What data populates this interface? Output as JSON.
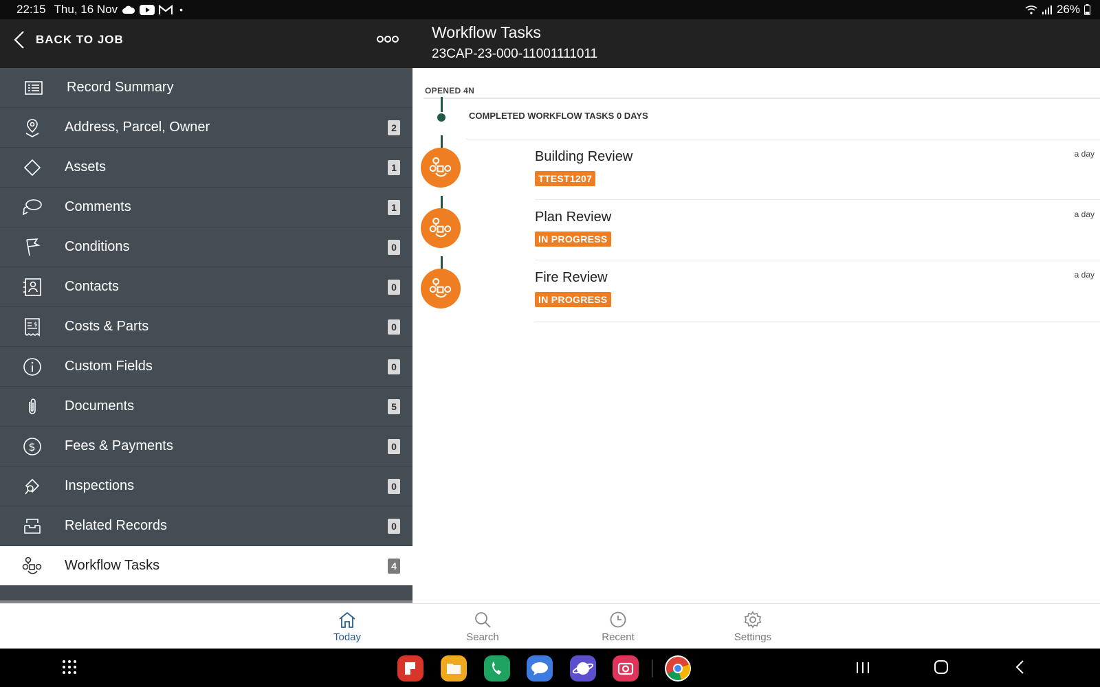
{
  "status": {
    "time": "22:15",
    "date": "Thu, 16 Nov",
    "battery": "26%",
    "notification_icons": [
      "cloud-icon",
      "youtube-icon",
      "gmail-icon",
      "dot-icon"
    ]
  },
  "header": {
    "back_label": "BACK TO JOB",
    "more_label": "ooo",
    "title": "Workflow Tasks",
    "subtitle": "23CAP-23-000-11001111011"
  },
  "sidebar": {
    "items": [
      {
        "label": "Record Summary",
        "count": null,
        "icon": "record-summary-icon"
      },
      {
        "label": "Address, Parcel, Owner",
        "count": "2",
        "icon": "location-pin-icon"
      },
      {
        "label": "Assets",
        "count": "1",
        "icon": "diamond-icon"
      },
      {
        "label": "Comments",
        "count": "1",
        "icon": "chat-bubbles-icon"
      },
      {
        "label": "Conditions",
        "count": "0",
        "icon": "flags-icon"
      },
      {
        "label": "Contacts",
        "count": "0",
        "icon": "contact-card-icon"
      },
      {
        "label": "Costs & Parts",
        "count": "0",
        "icon": "receipt-icon"
      },
      {
        "label": "Custom Fields",
        "count": "0",
        "icon": "info-icon"
      },
      {
        "label": "Documents",
        "count": "5",
        "icon": "paperclip-icon"
      },
      {
        "label": "Fees & Payments",
        "count": "0",
        "icon": "dollar-icon"
      },
      {
        "label": "Inspections",
        "count": "0",
        "icon": "inspection-icon"
      },
      {
        "label": "Related Records",
        "count": "0",
        "icon": "inbox-icon"
      },
      {
        "label": "Workflow Tasks",
        "count": "4",
        "icon": "workflow-icon"
      }
    ]
  },
  "timeline": {
    "opened_label": "OPENED 4N",
    "completed_label": "COMPLETED WORKFLOW TASKS 0 DAYS",
    "tasks": [
      {
        "name": "Building Review",
        "badge": "TTEST1207",
        "time": "a day"
      },
      {
        "name": "Plan Review",
        "badge": "IN PROGRESS",
        "time": "a day"
      },
      {
        "name": "Fire Review",
        "badge": "IN PROGRESS",
        "time": "a day"
      }
    ]
  },
  "bottom_nav": {
    "tabs": [
      {
        "label": "Today",
        "icon": "home-icon"
      },
      {
        "label": "Search",
        "icon": "search-icon"
      },
      {
        "label": "Recent",
        "icon": "clock-icon"
      },
      {
        "label": "Settings",
        "icon": "gear-icon"
      }
    ],
    "active": "Today"
  },
  "android_bar": {
    "apps": [
      {
        "name": "app-red",
        "color": "#d8352a"
      },
      {
        "name": "app-files",
        "color": "#f0a91e"
      },
      {
        "name": "app-phone",
        "color": "#1fa363"
      },
      {
        "name": "app-messages",
        "color": "#3d7be0"
      },
      {
        "name": "app-internet",
        "color": "#5b4fcf"
      },
      {
        "name": "app-camera",
        "color": "#e0345a"
      },
      {
        "name": "app-chrome",
        "color": "#ffffff"
      }
    ]
  },
  "colors": {
    "accent_orange": "#ef7d22",
    "timeline_green": "#1f5a44",
    "sidebar_bg": "#444c54",
    "header_bg": "#222222",
    "active_tab": "#2a5d8a"
  }
}
